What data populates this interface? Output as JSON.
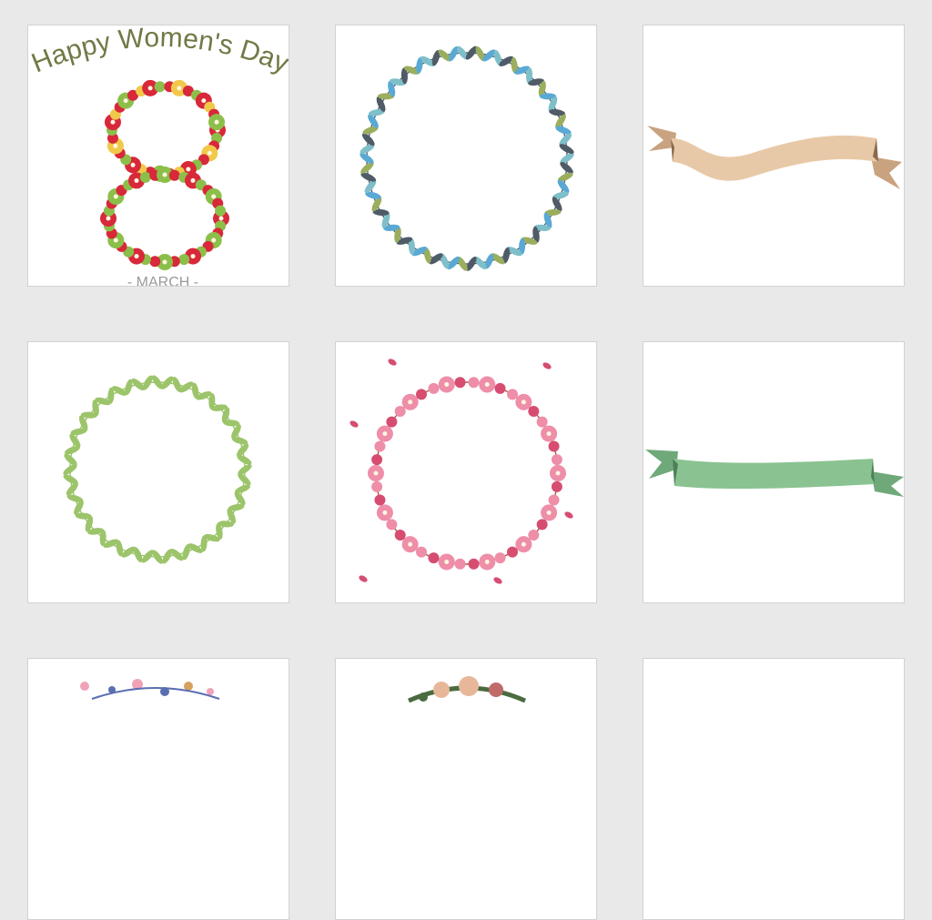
{
  "gallery": {
    "tiles": [
      {
        "name": "womens-day-wreath",
        "heading": "Happy Women's Day",
        "subheading": "- MARCH -",
        "colors": {
          "text": "#6f7a46",
          "flower": "#d8283a",
          "leaf": "#8cbf4a",
          "sub": "#9a9a9a"
        }
      },
      {
        "name": "blue-leaf-wreath",
        "colors": {
          "leaf": "#7fbfc9",
          "dark": "#4f5b66",
          "olive": "#9aae5e",
          "flower": "#5aa9d4"
        }
      },
      {
        "name": "beige-ribbon-banner",
        "colors": {
          "front": "#e8c9a7",
          "back": "#c9a27f",
          "fold": "#8a6a4e"
        }
      },
      {
        "name": "green-vine-wreath",
        "colors": {
          "leaf": "#9cc46a"
        }
      },
      {
        "name": "pink-cherry-blossom-wreath",
        "colors": {
          "petal": "#ee8ea8",
          "deep": "#d64d71",
          "branch": "#a35c44"
        }
      },
      {
        "name": "green-ribbon-banner",
        "colors": {
          "front": "#8ac391",
          "back": "#6fa97a",
          "fold": "#4d7f58"
        }
      },
      {
        "name": "watercolor-floral-spray",
        "colors": {
          "a": "#f0a3b8",
          "b": "#5b6fb0",
          "c": "#d7a15e"
        }
      },
      {
        "name": "rose-garland",
        "colors": {
          "a": "#e8b79a",
          "b": "#4a6b3f",
          "c": "#c06a6a"
        }
      },
      {
        "name": "blank-tile",
        "colors": {}
      }
    ]
  }
}
